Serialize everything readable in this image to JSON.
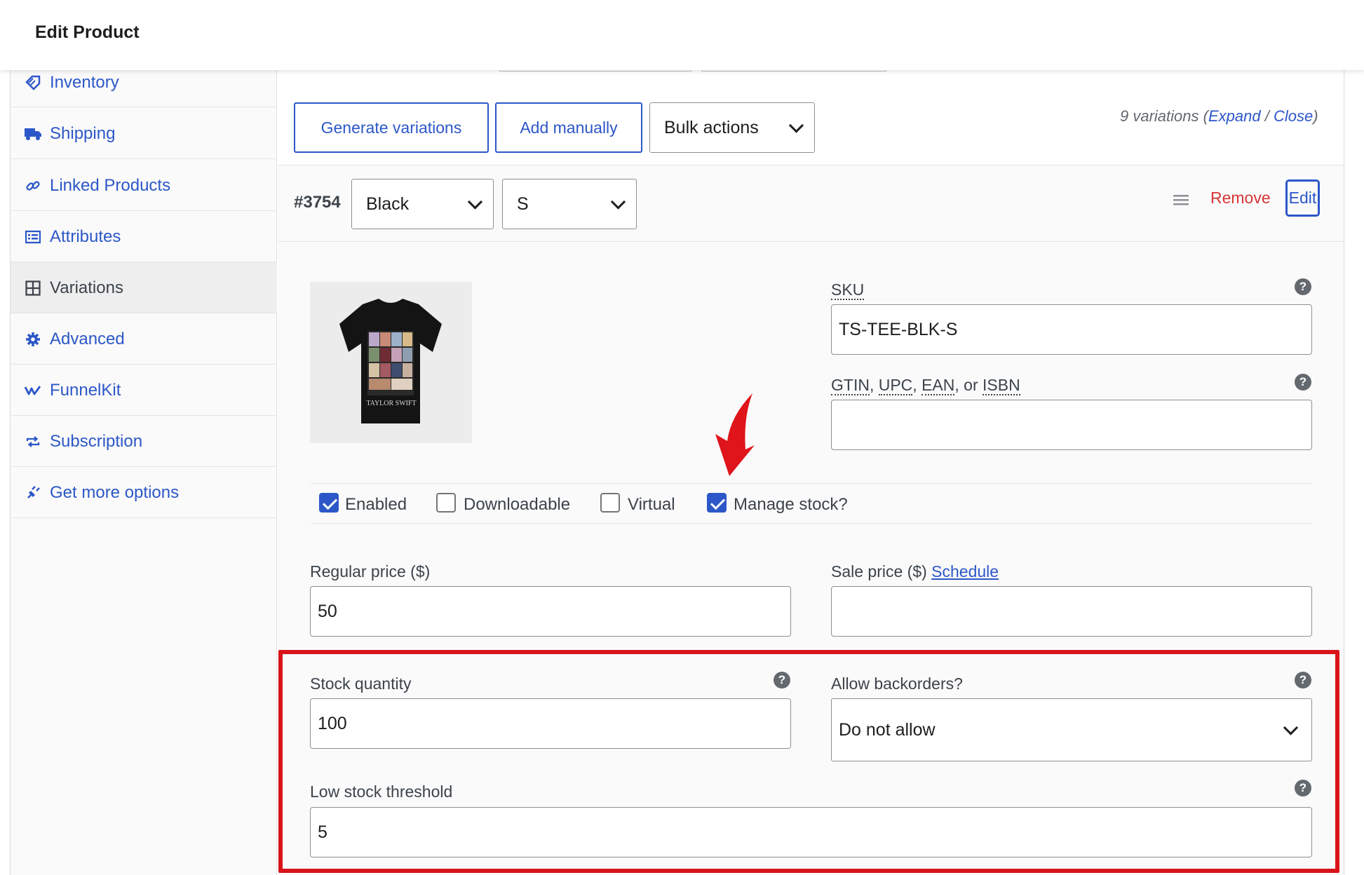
{
  "header": {
    "title": "Edit Product"
  },
  "sidebar": {
    "items": [
      {
        "label": "Inventory",
        "icon": "tag-icon"
      },
      {
        "label": "Shipping",
        "icon": "truck-icon"
      },
      {
        "label": "Linked Products",
        "icon": "link-icon"
      },
      {
        "label": "Attributes",
        "icon": "list-icon"
      },
      {
        "label": "Variations",
        "icon": "grid-icon",
        "active": true
      },
      {
        "label": "Advanced",
        "icon": "gear-icon"
      },
      {
        "label": "FunnelKit",
        "icon": "funnelkit-icon"
      },
      {
        "label": "Subscription",
        "icon": "repeat-icon"
      },
      {
        "label": "Get more options",
        "icon": "plugin-icon"
      }
    ]
  },
  "toolbar": {
    "generate_label": "Generate variations",
    "add_manually_label": "Add manually",
    "bulk_actions_label": "Bulk actions",
    "count_text": "9 variations",
    "expand_label": "Expand",
    "separator": "/",
    "close_label": "Close",
    "paren_open": "(",
    "paren_close": ")"
  },
  "variation": {
    "id": "#3754",
    "color_value": "Black",
    "size_value": "S",
    "remove_label": "Remove",
    "edit_label": "Edit"
  },
  "image": {
    "print_text": "TAYLOR SWIFT"
  },
  "fields": {
    "sku_label": "SKU",
    "sku_value": "TS-TEE-BLK-S",
    "gtin_label_parts": [
      "GTIN",
      ", ",
      "UPC",
      ", ",
      "EAN",
      ", or ",
      "ISBN"
    ],
    "gtin_value": "",
    "regular_price_label": "Regular price ($)",
    "regular_price_value": "50",
    "sale_price_label": "Sale price ($)",
    "schedule_label": "Schedule",
    "sale_price_value": "",
    "stock_quantity_label": "Stock quantity",
    "stock_quantity_value": "100",
    "backorders_label": "Allow backorders?",
    "backorders_value": "Do not allow",
    "low_stock_label": "Low stock threshold",
    "low_stock_value": "5",
    "help_glyph": "?"
  },
  "checkboxes": {
    "enabled_label": "Enabled",
    "enabled_checked": true,
    "downloadable_label": "Downloadable",
    "downloadable_checked": false,
    "virtual_label": "Virtual",
    "virtual_checked": false,
    "manage_stock_label": "Manage stock?",
    "manage_stock_checked": true
  },
  "colors": {
    "accent": "#2c57c8",
    "remove": "#d63638",
    "highlight_box": "#d9141b",
    "arrow": "#e0141b"
  }
}
